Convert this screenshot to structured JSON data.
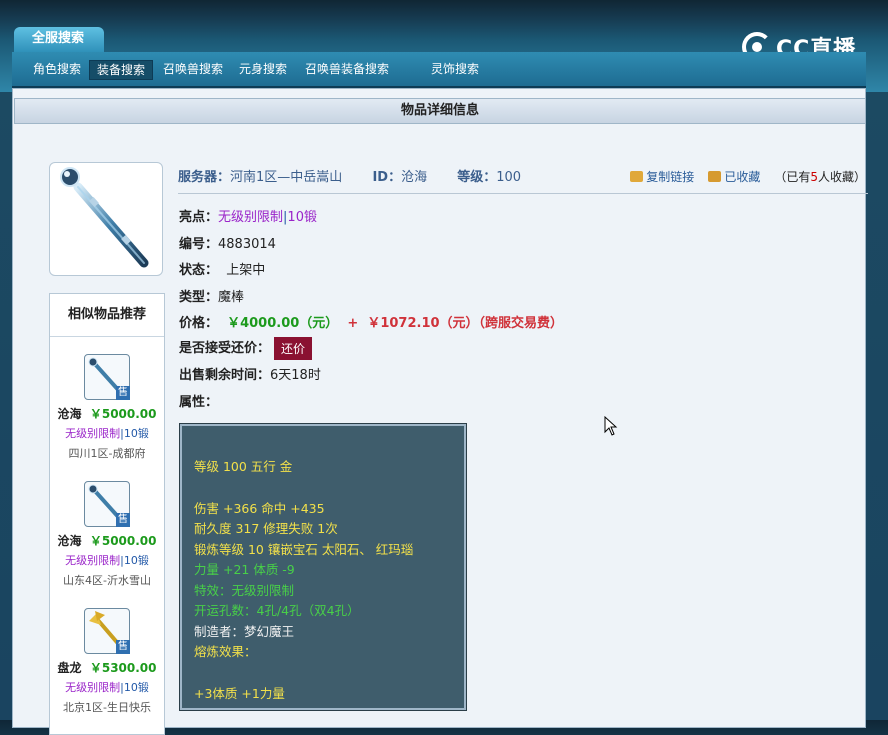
{
  "top_tab": "全服搜索",
  "brand": "CC直播",
  "subnav": [
    "角色搜索",
    "装备搜索",
    "召唤兽搜索",
    "元身搜索",
    "召唤兽装备搜索",
    "灵饰搜索"
  ],
  "panel_title": "物品详细信息",
  "server": {
    "label": "服务器：",
    "value": "河南1区—中岳嵩山",
    "id_label": "ID：",
    "id_value": "沧海",
    "level_label": "等级：",
    "level_value": "100"
  },
  "actions": {
    "copy_link": "复制链接",
    "favorited": "已收藏",
    "fav_count_prefix": "（已有",
    "fav_count": "5",
    "fav_count_suffix": "人收藏）"
  },
  "details": {
    "highlight_label": "亮点：",
    "highlight_1": "无级别限制",
    "highlight_sep": "|",
    "highlight_2": "10锻",
    "number_label": "编号：",
    "number": "4883014",
    "status_label": "状态：",
    "status": "上架中",
    "type_label": "类型：",
    "type": "魔棒",
    "price_label": "价格：",
    "price": "￥4000.00（元）",
    "plus": "+",
    "fee": "￥1072.10（元）（跨服交易费）",
    "offer_label": "是否接受还价：",
    "offer_button": "还价",
    "time_label": "出售剩余时间：",
    "time": "6天18时",
    "attr_label": "属性："
  },
  "attributes": [
    "等级 100 五行 金",
    "伤害 +366 命中 +435",
    "耐久度 317 修理失败 1次",
    "锻炼等级 10 镶嵌宝石 太阳石、 红玛瑙",
    "力量 +21 体质 -9",
    "特效：无级别限制",
    "开运孔数：4孔/4孔（双4孔）",
    "制造者：梦幻魔王",
    "熔炼效果：",
    "+3体质 +1力量"
  ],
  "similar": {
    "title": "相似物品推荐",
    "sold_badge": "售",
    "items": [
      {
        "name": "沧海",
        "price": "￥5000.00",
        "tag1": "无级别限制",
        "tag_sep": "|",
        "tag2": "10锻",
        "server": "四川1区-成都府"
      },
      {
        "name": "沧海",
        "price": "￥5000.00",
        "tag1": "无级别限制",
        "tag_sep": "|",
        "tag2": "10锻",
        "server": "山东4区-沂水雪山"
      },
      {
        "name": "盘龙",
        "price": "￥5300.00",
        "tag1": "无级别限制",
        "tag_sep": "|",
        "tag2": "10锻",
        "server": "北京1区-生日快乐"
      }
    ]
  },
  "colors": {
    "accent_blue": "#2f8cb2",
    "price_red": "#d0323a",
    "price_green": "#1c9a1c",
    "highlight_purple": "#9a24c9",
    "offer_button": "#8a1131",
    "attr_bg": "#3f5d6c"
  }
}
